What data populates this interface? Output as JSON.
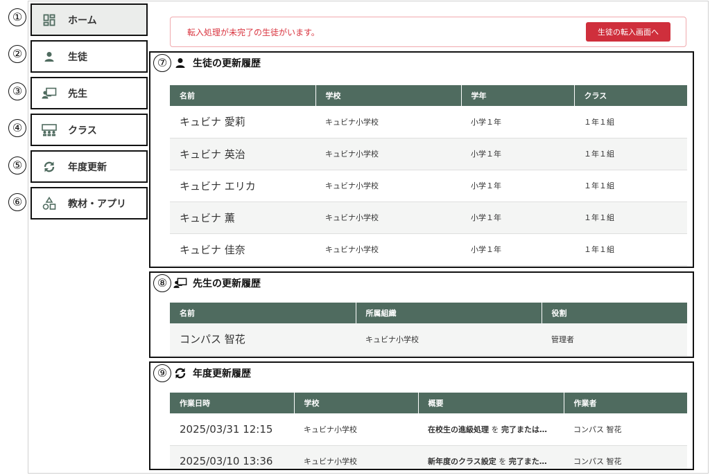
{
  "markers": [
    "①",
    "②",
    "③",
    "④",
    "⑤",
    "⑥",
    "⑦",
    "⑧",
    "⑨"
  ],
  "sidebar": {
    "items": [
      {
        "label": "ホーム",
        "icon": "dashboard-icon"
      },
      {
        "label": "生徒",
        "icon": "person-icon"
      },
      {
        "label": "先生",
        "icon": "teacher-board-icon"
      },
      {
        "label": "クラス",
        "icon": "class-group-icon"
      },
      {
        "label": "年度更新",
        "icon": "refresh-icon"
      },
      {
        "label": "教材・アプリ",
        "icon": "shapes-icon"
      }
    ]
  },
  "alert": {
    "message": "転入処理が未完了の生徒がいます。",
    "button_label": "生徒の転入画面へ"
  },
  "students": {
    "title": "生徒の更新履歴",
    "columns": [
      "名前",
      "学校",
      "学年",
      "クラス"
    ],
    "rows": [
      [
        "キュビナ 愛莉",
        "キュビナ小学校",
        "小学１年",
        "１年１組"
      ],
      [
        "キュビナ 英治",
        "キュビナ小学校",
        "小学１年",
        "１年１組"
      ],
      [
        "キュビナ エリカ",
        "キュビナ小学校",
        "小学１年",
        "１年１組"
      ],
      [
        "キュビナ 薫",
        "キュビナ小学校",
        "小学１年",
        "１年１組"
      ],
      [
        "キュビナ 佳奈",
        "キュビナ小学校",
        "小学１年",
        "１年１組"
      ]
    ]
  },
  "teachers": {
    "title": "先生の更新履歴",
    "columns": [
      "名前",
      "所属組織",
      "役割"
    ],
    "rows": [
      [
        "コンパス 智花",
        "キュビナ小学校",
        "管理者"
      ]
    ]
  },
  "year_update": {
    "title": "年度更新履歴",
    "columns": [
      "作業日時",
      "学校",
      "概要",
      "作業者"
    ],
    "rows": [
      {
        "datetime": "2025/03/31 12:15",
        "school": "キュビナ小学校",
        "summary_a": "在校生の進級処理",
        "summary_b": " を ",
        "summary_c": "完了または…",
        "operator": "コンパス 智花"
      },
      {
        "datetime": "2025/03/10 13:36",
        "school": "キュビナ小学校",
        "summary_a": "新年度のクラス設定",
        "summary_b": " を ",
        "summary_c": "完了また…",
        "operator": "コンパス 智花"
      }
    ]
  },
  "colors": {
    "accent_green": "#4f6b5f",
    "alert_red": "#d9343f",
    "alert_button": "#cf2f3c"
  }
}
